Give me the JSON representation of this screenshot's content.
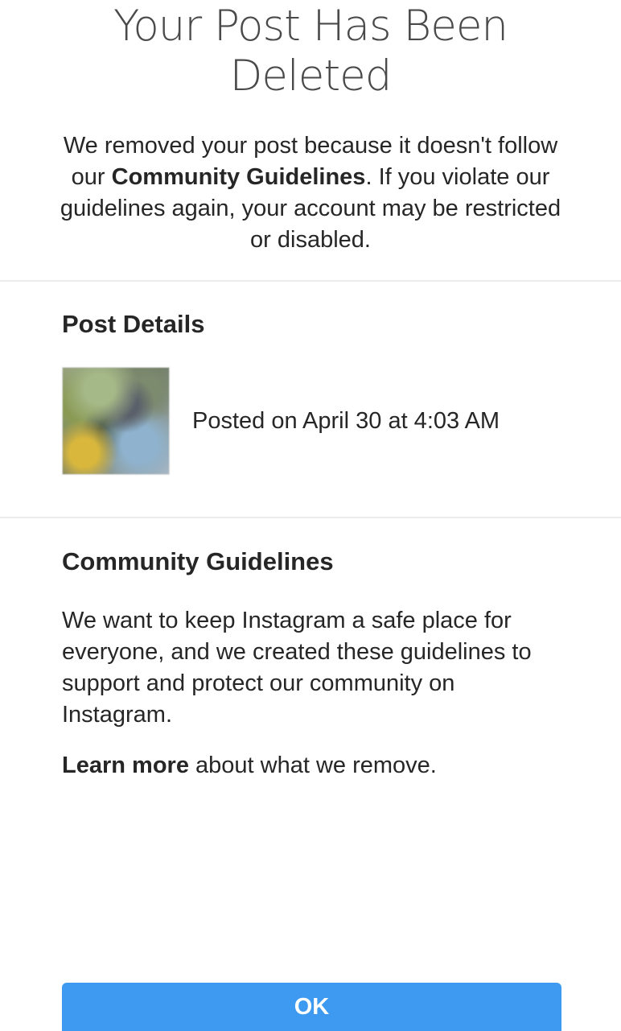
{
  "header": {
    "title": "Your Post Has Been Deleted",
    "intro": {
      "before": "We removed your post because it doesn't follow our ",
      "link": "Community Guidelines",
      "after": ". If you violate our guidelines again, your account may be restricted or disabled."
    }
  },
  "post_details": {
    "heading": "Post Details",
    "thumbnail_icon": "blurred-post-thumbnail",
    "posted_on": "Posted on April 30 at 4:03 AM"
  },
  "community_guidelines": {
    "heading": "Community Guidelines",
    "body": "We want to keep Instagram a safe place for everyone, and we created these guidelines to support and protect our community on Instagram.",
    "learn_more_link": "Learn more",
    "learn_more_rest": " about what we remove."
  },
  "footer": {
    "ok_label": "OK"
  },
  "colors": {
    "accent": "#3d9af0",
    "text": "#262626",
    "divider": "#ececec"
  }
}
